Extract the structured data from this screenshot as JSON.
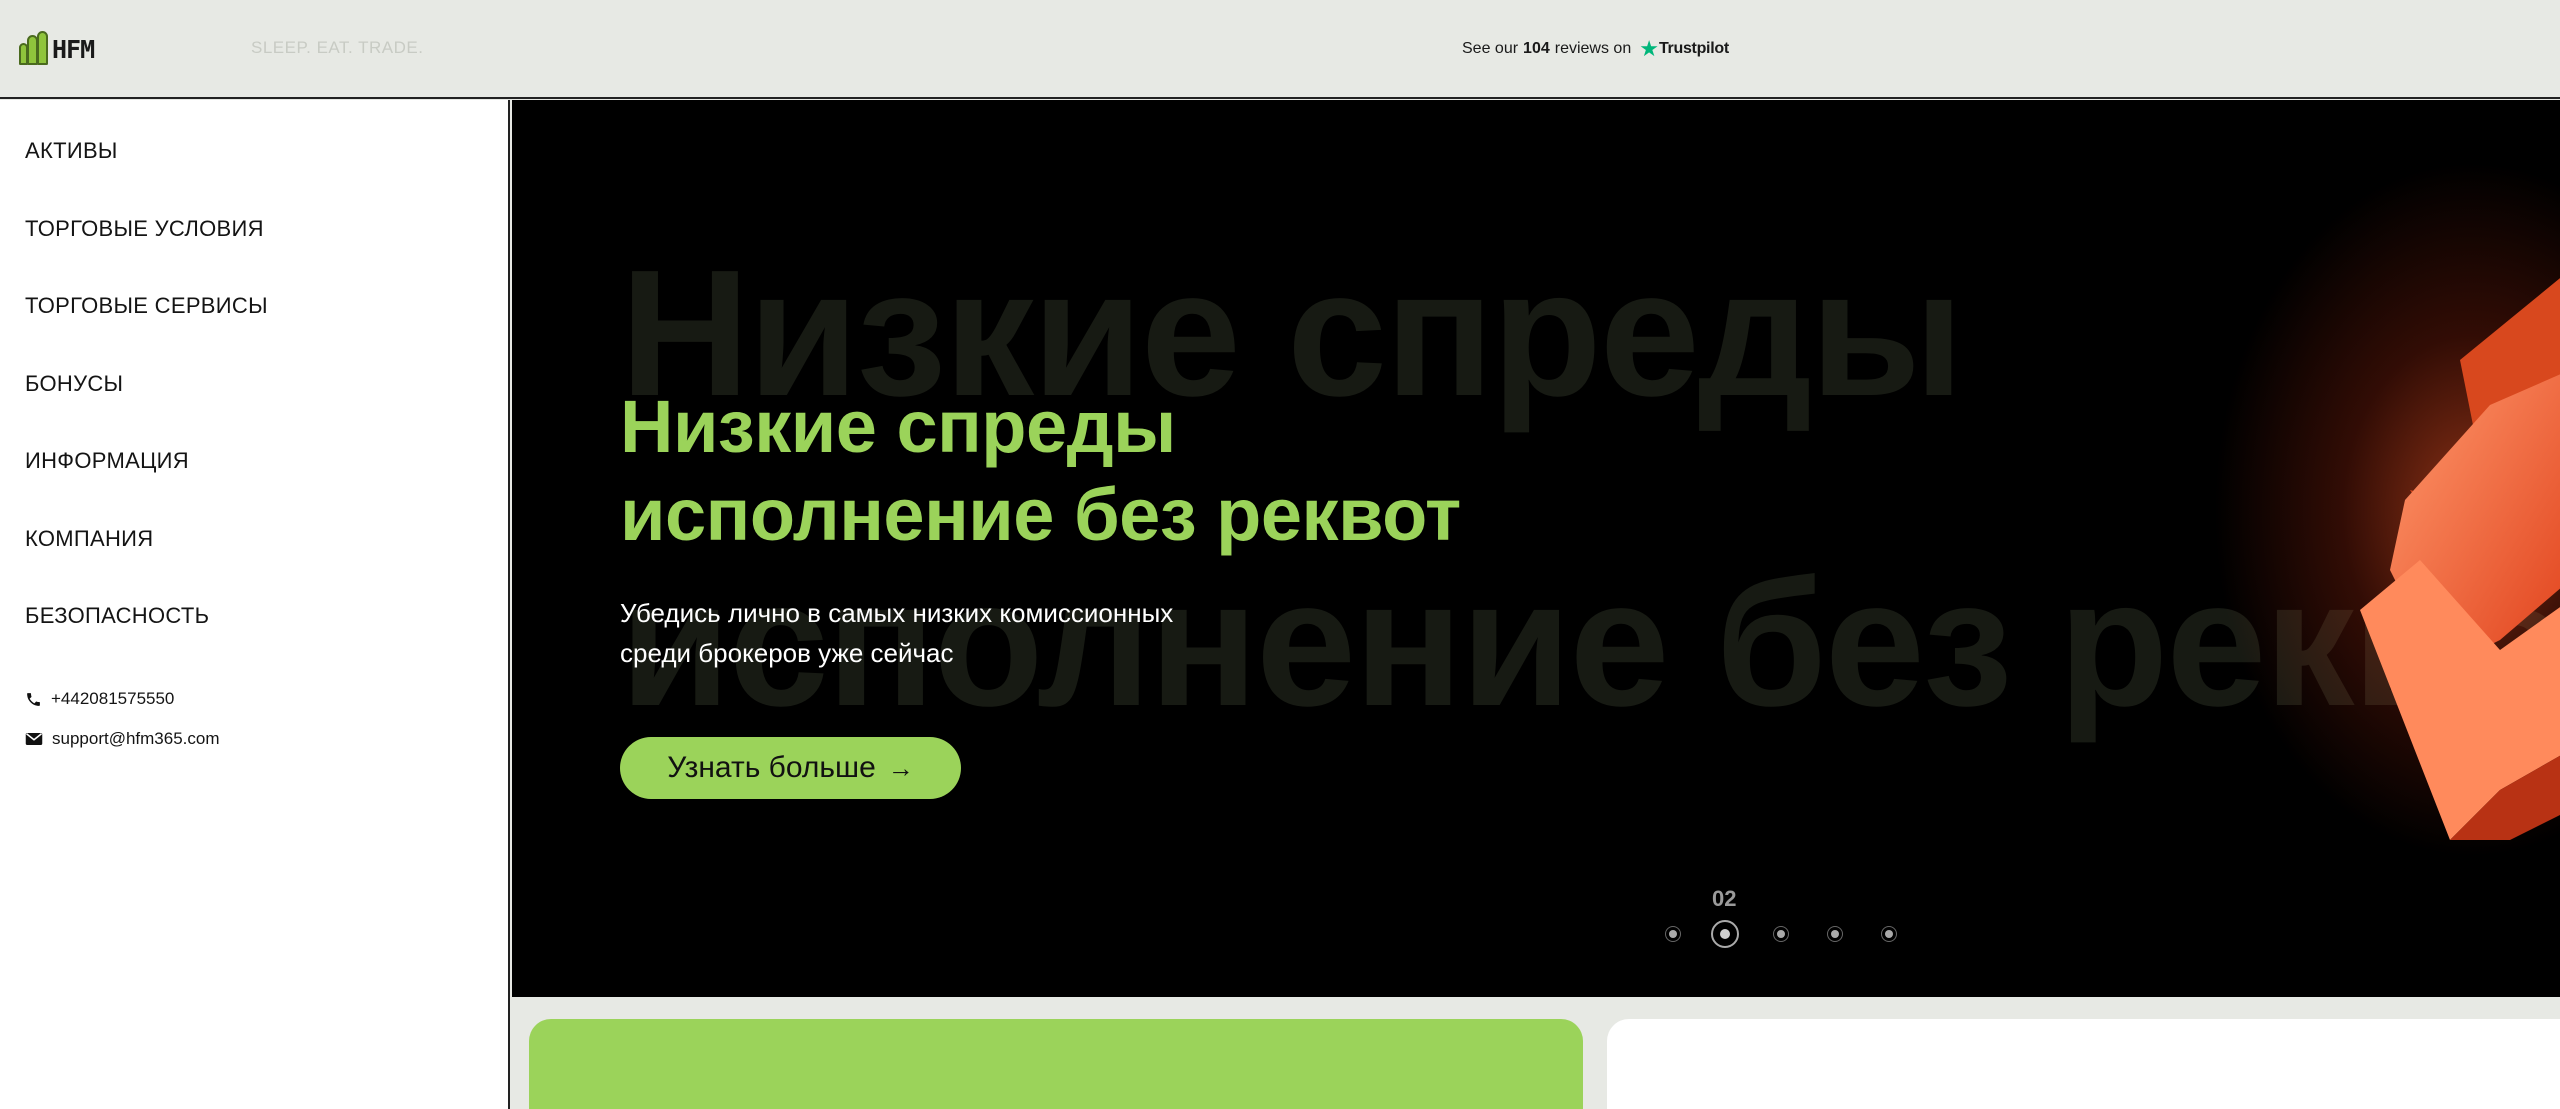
{
  "header": {
    "logo_text": "HFM",
    "tagline": "SLEEP. EAT. TRADE.",
    "trustpilot": {
      "prefix": "See our",
      "count": "104",
      "suffix": "reviews on",
      "brand": "Trustpilot"
    }
  },
  "sidebar": {
    "items": [
      {
        "label": "АКТИВЫ"
      },
      {
        "label": "ТОРГОВЫЕ УСЛОВИЯ"
      },
      {
        "label": "ТОРГОВЫЕ СЕРВИСЫ"
      },
      {
        "label": "БОНУСЫ"
      },
      {
        "label": "ИНФОРМАЦИЯ"
      },
      {
        "label": "КОМПАНИЯ"
      },
      {
        "label": "БЕЗОПАСНОСТЬ"
      }
    ],
    "phone": "+442081575550",
    "email": "support@hfm365.com"
  },
  "hero": {
    "ghost_line1": "Низкие спреды",
    "ghost_line2": "исполнение без реквот",
    "title_line1": "Низкие спреды",
    "title_line2": "исполнение без реквот",
    "subtitle_line1": "Убедись лично в самых низких комиссионных",
    "subtitle_line2": "среди брокеров уже сейчас",
    "cta_label": "Узнать больше",
    "slide_number": "02",
    "slide_count": 5,
    "active_slide": 2
  },
  "colors": {
    "accent": "#9bd35a",
    "background": "#e7e9e4",
    "hero_bg": "#000000",
    "trustpilot_star": "#00b67a"
  }
}
